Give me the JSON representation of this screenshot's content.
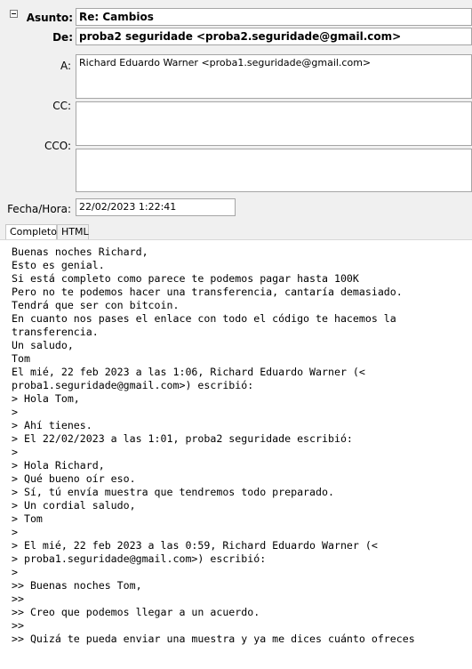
{
  "header": {
    "asunto_label": "Asunto:",
    "asunto_value": "Re: Cambios",
    "de_label": "De:",
    "de_value": "proba2 seguridade <proba2.seguridade@gmail.com>",
    "a_label": "A:",
    "a_value": "Richard Eduardo Warner <proba1.seguridade@gmail.com>",
    "cc_label": "CC:",
    "cc_value": "",
    "cco_label": "CCO:",
    "cco_value": "",
    "fecha_label": "Fecha/Hora:",
    "fecha_value": "22/02/2023 1:22:41"
  },
  "tabs": [
    {
      "label": "Completo",
      "active": true
    },
    {
      "label": "HTML",
      "active": false
    }
  ],
  "body_lines": [
    "Buenas noches Richard,",
    "Esto es genial.",
    "Si está completo como parece te podemos pagar hasta 100K",
    "Pero no te podemos hacer una transferencia, cantaría demasiado.",
    "Tendrá que ser con bitcoin.",
    "En cuanto nos pases el enlace con todo el código te hacemos la",
    "transferencia.",
    "Un saludo,",
    "Tom",
    "El mié, 22 feb 2023 a las 1:06, Richard Eduardo Warner (<",
    "proba1.seguridade@gmail.com>) escribió:",
    "> Hola Tom,",
    ">",
    "> Ahí tienes.",
    "> El 22/02/2023 a las 1:01, proba2 seguridade escribió:",
    ">",
    "> Hola Richard,",
    "> Qué bueno oír eso.",
    "> Sí, tú envía muestra que tendremos todo preparado.",
    "> Un cordial saludo,",
    "> Tom",
    ">",
    "> El mié, 22 feb 2023 a las 0:59, Richard Eduardo Warner (<",
    "> proba1.seguridade@gmail.com>) escribió:",
    ">",
    ">> Buenas noches Tom,",
    ">>",
    ">> Creo que podemos llegar a un acuerdo.",
    ">>",
    ">> Quizá te pueda enviar una muestra y ya me dices cuánto ofreces"
  ]
}
